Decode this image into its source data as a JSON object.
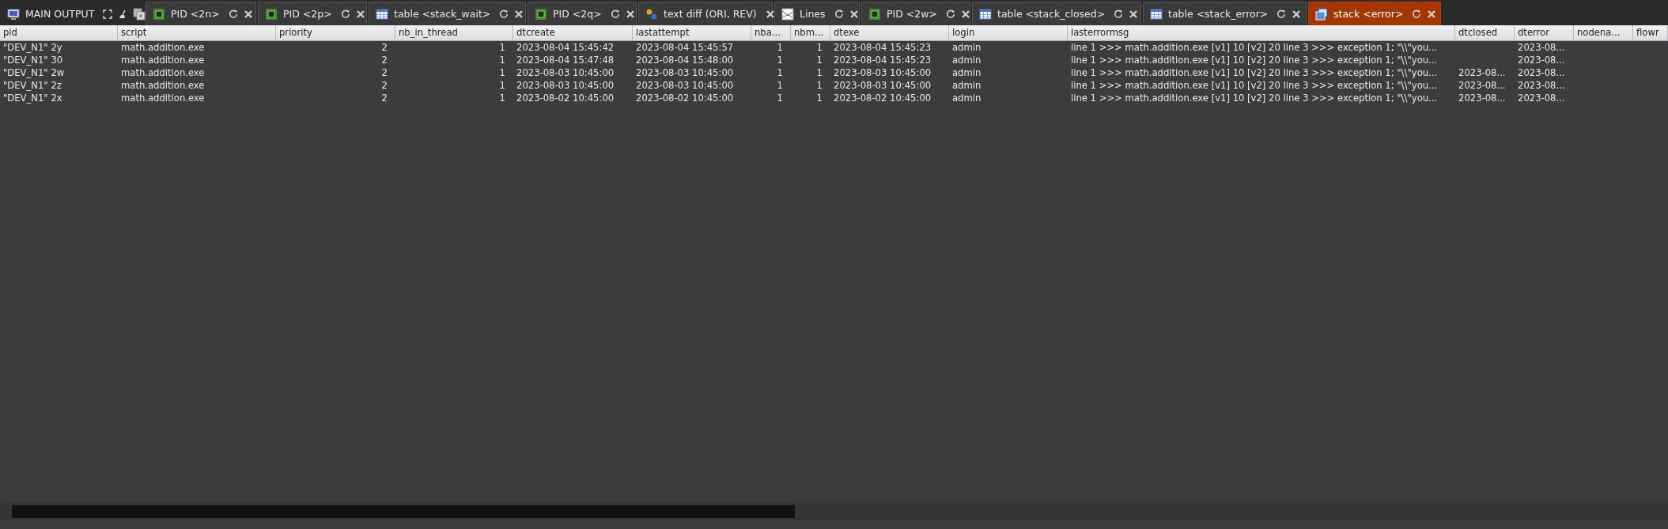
{
  "tabs": [
    {
      "kind": "main",
      "label": "MAIN OUTPUT",
      "reload": false,
      "closable": false,
      "selected": false
    },
    {
      "kind": "chip",
      "label": "PID <2n>",
      "reload": true,
      "closable": true,
      "selected": false
    },
    {
      "kind": "chip",
      "label": "PID <2p>",
      "reload": true,
      "closable": true,
      "selected": false
    },
    {
      "kind": "table",
      "label": "table <stack_wait>",
      "reload": true,
      "closable": true,
      "selected": false
    },
    {
      "kind": "chip",
      "label": "PID <2q>",
      "reload": true,
      "closable": true,
      "selected": false
    },
    {
      "kind": "diff",
      "label": "text diff (ORI, REV)",
      "reload": false,
      "closable": true,
      "selected": false
    },
    {
      "kind": "chart",
      "label": "Lines",
      "reload": true,
      "closable": true,
      "selected": false
    },
    {
      "kind": "chip",
      "label": "PID <2w>",
      "reload": true,
      "closable": true,
      "selected": false
    },
    {
      "kind": "table",
      "label": "table <stack_closed>",
      "reload": true,
      "closable": true,
      "selected": false
    },
    {
      "kind": "table",
      "label": "table <stack_error>",
      "reload": true,
      "closable": true,
      "selected": false
    },
    {
      "kind": "stack",
      "label": "stack <error>",
      "reload": true,
      "closable": true,
      "selected": true
    }
  ],
  "table": {
    "columns": [
      {
        "label": "pid"
      },
      {
        "label": "script"
      },
      {
        "label": "priority"
      },
      {
        "label": "nb_in_thread"
      },
      {
        "label": "dtcreate"
      },
      {
        "label": "lastattempt"
      },
      {
        "label": "nba..."
      },
      {
        "label": "nbm..."
      },
      {
        "label": "dtexe"
      },
      {
        "label": "login"
      },
      {
        "label": "lasterrormsg"
      },
      {
        "label": "dtclosed"
      },
      {
        "label": "dterror"
      },
      {
        "label": "nodena..."
      },
      {
        "label": "flowr"
      }
    ],
    "rows": [
      [
        "\"DEV_N1\" 2y",
        "math.addition.exe",
        "2",
        "1",
        "2023-08-04 15:45:42",
        "2023-08-04 15:45:57",
        "1",
        "1",
        "2023-08-04 15:45:23",
        "admin",
        "line 1 >>> math.addition.exe [v1] 10 [v2] 20 line 3 >>> exception 1; \"\\\\\"you...",
        "",
        "2023-08...",
        "",
        ""
      ],
      [
        "\"DEV_N1\" 30",
        "math.addition.exe",
        "2",
        "1",
        "2023-08-04 15:47:48",
        "2023-08-04 15:48:00",
        "1",
        "1",
        "2023-08-04 15:45:23",
        "admin",
        "line 1 >>> math.addition.exe [v1] 10 [v2] 20 line 3 >>> exception 1; \"\\\\\"you...",
        "",
        "2023-08...",
        "",
        ""
      ],
      [
        "\"DEV_N1\" 2w",
        "math.addition.exe",
        "2",
        "1",
        "2023-08-03 10:45:00",
        "2023-08-03 10:45:00",
        "1",
        "1",
        "2023-08-03 10:45:00",
        "admin",
        "line 1 >>> math.addition.exe [v1] 10 [v2] 20 line 3 >>> exception 1; \"\\\\\"you...",
        "2023-08...",
        "2023-08...",
        "",
        ""
      ],
      [
        "\"DEV_N1\" 2z",
        "math.addition.exe",
        "2",
        "1",
        "2023-08-03 10:45:00",
        "2023-08-03 10:45:00",
        "1",
        "1",
        "2023-08-03 10:45:00",
        "admin",
        "line 1 >>> math.addition.exe [v1] 10 [v2] 20 line 3 >>> exception 1; \"\\\\\"you...",
        "2023-08...",
        "2023-08...",
        "",
        ""
      ],
      [
        "\"DEV_N1\" 2x",
        "math.addition.exe",
        "2",
        "1",
        "2023-08-02 10:45:00",
        "2023-08-02 10:45:00",
        "1",
        "1",
        "2023-08-02 10:45:00",
        "admin",
        "line 1 >>> math.addition.exe [v1] 10 [v2] 20 line 3 >>> exception 1; \"\\\\\"you...",
        "2023-08...",
        "2023-08...",
        "",
        ""
      ]
    ]
  }
}
